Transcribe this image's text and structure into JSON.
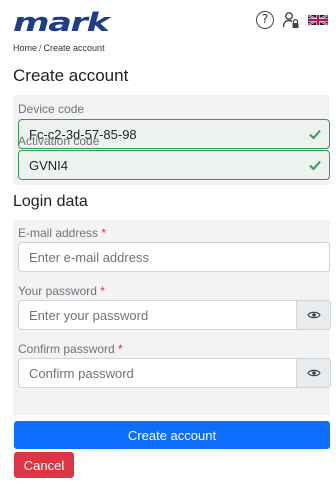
{
  "header": {
    "logo_text": "mark",
    "help_icon": "question-circle-icon",
    "user_icon": "user-lock-icon",
    "flag_icon": "uk-flag-icon",
    "help_glyph": "?"
  },
  "breadcrumb": {
    "home": "Home",
    "separator": "/",
    "current": "Create account"
  },
  "page_title": "Create account",
  "device": {
    "label": "Device code",
    "value": "Fc-c2-3d-57-85-98"
  },
  "activation": {
    "label": "Activation code",
    "value": "GVNI4"
  },
  "login_section_title": "Login data",
  "email": {
    "label": "E-mail address",
    "required_marker": "*",
    "placeholder": "Enter e-mail address",
    "value": ""
  },
  "password": {
    "label": "Your password",
    "required_marker": "*",
    "placeholder": "Enter your password",
    "value": ""
  },
  "confirm": {
    "label": "Confirm password",
    "required_marker": "*",
    "placeholder": "Confirm password",
    "value": ""
  },
  "buttons": {
    "create": "Create account",
    "cancel": "Cancel"
  },
  "colors": {
    "brand": "#1e3f86",
    "primary": "#0d6efd",
    "danger": "#dc3545",
    "valid": "#2f9e5a"
  }
}
